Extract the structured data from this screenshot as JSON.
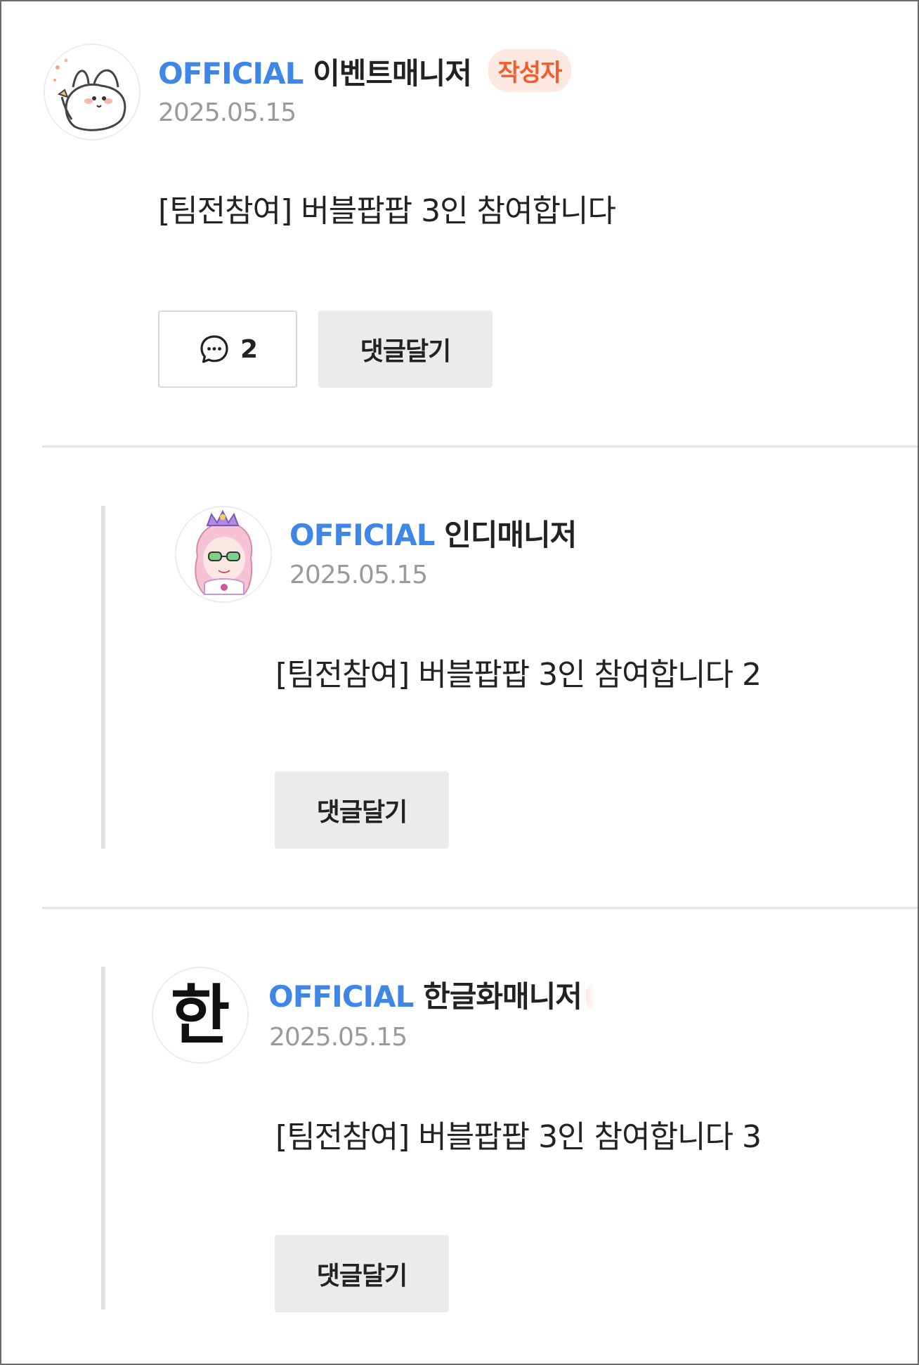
{
  "post": {
    "official_label": "OFFICIAL",
    "nickname": "이벤트매니저",
    "author_badge": "작성자",
    "date": "2025.05.15",
    "message": "[팀전참여] 버블팝팝 3인 참여합니다",
    "comment_count": "2",
    "reply_label": "댓글달기"
  },
  "replies": [
    {
      "official_label": "OFFICIAL",
      "nickname": "인디매니저",
      "date": "2025.05.15",
      "message": "[팀전참여] 버블팝팝 3인 참여합니다 2",
      "reply_label": "댓글달기"
    },
    {
      "official_label": "OFFICIAL",
      "nickname": "한글화매니저",
      "date": "2025.05.15",
      "message": "[팀전참여] 버블팝팝 3인 참여합니다 3",
      "reply_label": "댓글달기",
      "avatar_glyph": "한"
    }
  ],
  "colors": {
    "official": "#3f86e6",
    "badge_bg": "#fde9e2",
    "badge_text": "#f25b2a",
    "button_bg": "#ebebeb"
  }
}
